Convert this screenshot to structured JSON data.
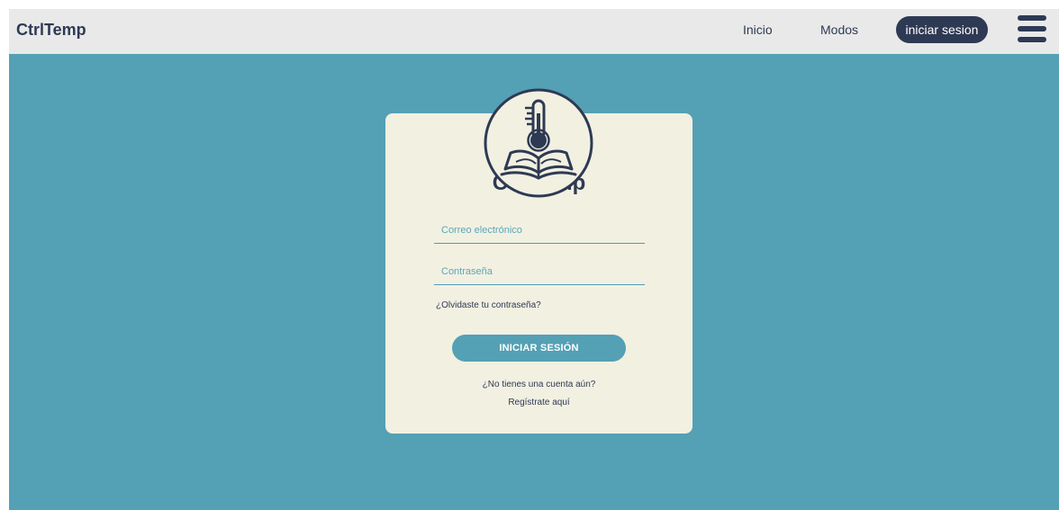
{
  "navbar": {
    "brand": "CtrlTemp",
    "links": {
      "home": "Inicio",
      "modes": "Modos"
    },
    "login_button": "iniciar sesion",
    "menu_icon": "hamburger-menu-icon"
  },
  "login": {
    "logo_icon": "thermometer-book-icon",
    "title": "CtrlTemp",
    "email_placeholder": "Correo electrónico",
    "password_placeholder": "Contraseña",
    "forgot_password": "¿Olvidaste tu contraseña?",
    "submit": "INICIAR SESIÓN",
    "no_account": "¿No tienes una cuenta aún?",
    "register": "Regístrate aquí"
  },
  "colors": {
    "navy": "#2e3a54",
    "teal": "#54a0b4",
    "card": "#f2f0e1",
    "navbar": "#e9e9e9"
  }
}
